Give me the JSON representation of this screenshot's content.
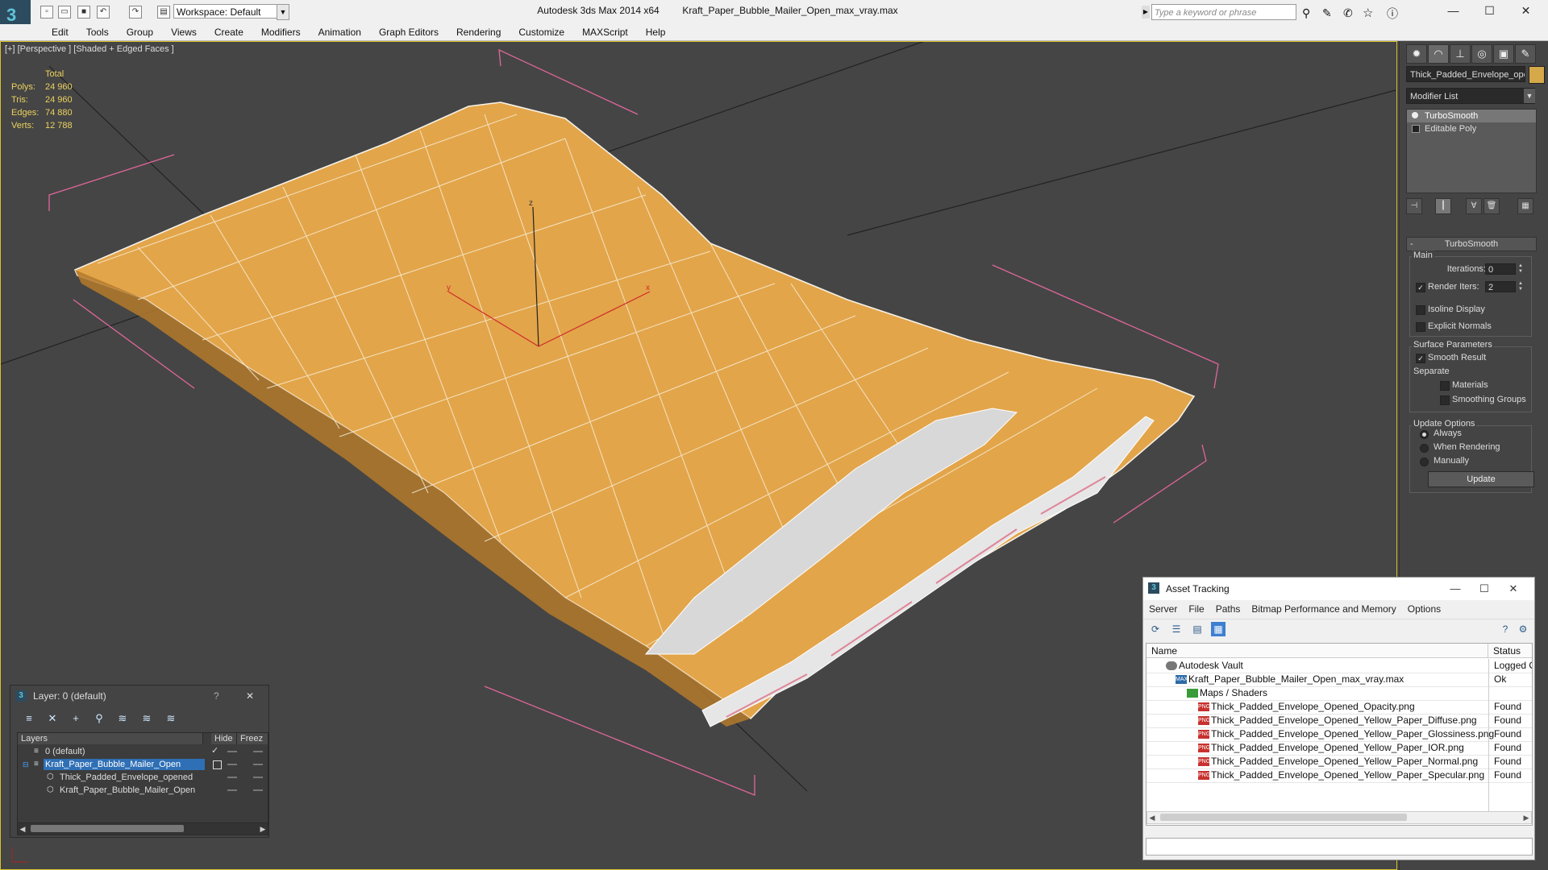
{
  "titlebar": {
    "workspace": "Workspace: Default",
    "app_title": "Autodesk 3ds Max  2014 x64",
    "file_title": "Kraft_Paper_Bubble_Mailer_Open_max_vray.max",
    "search_placeholder": "Type a keyword or phrase"
  },
  "menu": [
    "Edit",
    "Tools",
    "Group",
    "Views",
    "Create",
    "Modifiers",
    "Animation",
    "Graph Editors",
    "Rendering",
    "Customize",
    "MAXScript",
    "Help"
  ],
  "viewport": {
    "label": "[+] [Perspective ] [Shaded + Edged Faces ]",
    "stats": {
      "header": "Total",
      "rows": [
        {
          "label": "Polys:",
          "value": "24 960"
        },
        {
          "label": "Tris:",
          "value": "24 960"
        },
        {
          "label": "Edges:",
          "value": "74 880"
        },
        {
          "label": "Verts:",
          "value": "12 788"
        }
      ]
    },
    "gizmo": {
      "x_label": "x",
      "y_label": "y",
      "z_label": "z"
    }
  },
  "command_panel": {
    "object_name": "Thick_Padded_Envelope_ope",
    "object_color": "#d5a84a",
    "modifier_list": "Modifier List",
    "stack": [
      "TurboSmooth",
      "Editable Poly"
    ],
    "rollout_title": "TurboSmooth",
    "main": {
      "group": "Main",
      "iterations_label": "Iterations:",
      "iterations_value": "0",
      "render_iters_label": "Render Iters:",
      "render_iters_value": "2",
      "isoline": "Isoline Display",
      "explicit_normals": "Explicit Normals"
    },
    "surface": {
      "group": "Surface Parameters",
      "smooth_result": "Smooth Result",
      "separate": "Separate",
      "materials": "Materials",
      "smoothing_groups": "Smoothing Groups"
    },
    "update": {
      "group": "Update Options",
      "always": "Always",
      "when_rendering": "When Rendering",
      "manually": "Manually",
      "button": "Update"
    }
  },
  "layer_window": {
    "title": "Layer: 0 (default)",
    "help": "?",
    "columns": [
      "Layers",
      "Hide",
      "Freez"
    ],
    "rows": [
      {
        "name": "0 (default)",
        "indent": 0
      },
      {
        "name": "Kraft_Paper_Bubble_Mailer_Open",
        "indent": 0
      },
      {
        "name": "Thick_Padded_Envelope_opened",
        "indent": 1
      },
      {
        "name": "Kraft_Paper_Bubble_Mailer_Open",
        "indent": 1
      }
    ]
  },
  "asset_window": {
    "title": "Asset Tracking",
    "menu": [
      "Server",
      "File",
      "Paths",
      "Bitmap Performance and Memory",
      "Options"
    ],
    "columns": [
      "Name",
      "Status"
    ],
    "rows": [
      {
        "name": "Autodesk Vault",
        "status": "Logged O",
        "icon": "vault",
        "icon_text": ""
      },
      {
        "name": "Kraft_Paper_Bubble_Mailer_Open_max_vray.max",
        "status": "Ok",
        "icon": "max",
        "icon_text": "MAX"
      },
      {
        "name": "Maps / Shaders",
        "status": "",
        "icon": "folder",
        "icon_text": ""
      },
      {
        "name": "Thick_Padded_Envelope_Opened_Opacity.png",
        "status": "Found",
        "icon": "png",
        "icon_text": "PNG"
      },
      {
        "name": "Thick_Padded_Envelope_Opened_Yellow_Paper_Diffuse.png",
        "status": "Found",
        "icon": "png",
        "icon_text": "PNG"
      },
      {
        "name": "Thick_Padded_Envelope_Opened_Yellow_Paper_Glossiness.png",
        "status": "Found",
        "icon": "png",
        "icon_text": "PNG"
      },
      {
        "name": "Thick_Padded_Envelope_Opened_Yellow_Paper_IOR.png",
        "status": "Found",
        "icon": "png",
        "icon_text": "PNG"
      },
      {
        "name": "Thick_Padded_Envelope_Opened_Yellow_Paper_Normal.png",
        "status": "Found",
        "icon": "png",
        "icon_text": "PNG"
      },
      {
        "name": "Thick_Padded_Envelope_Opened_Yellow_Paper_Specular.png",
        "status": "Found",
        "icon": "png",
        "icon_text": "PNG"
      }
    ]
  }
}
